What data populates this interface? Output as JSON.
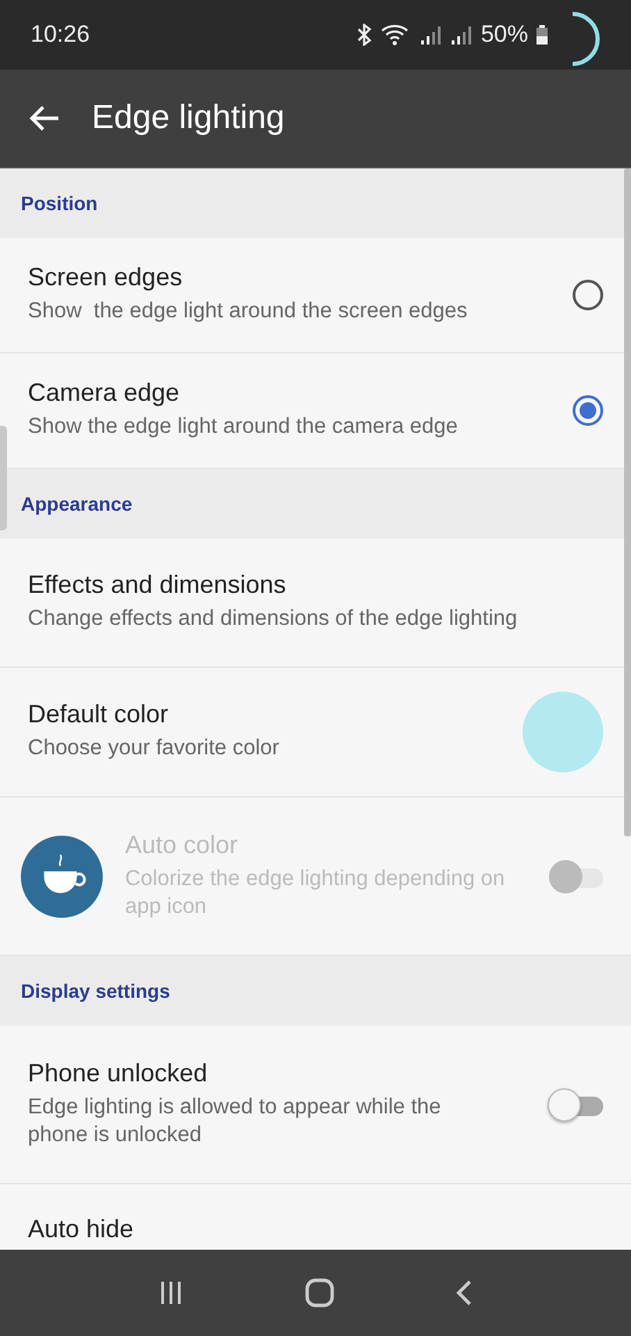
{
  "status_bar": {
    "time": "10:26",
    "battery": "50%"
  },
  "app_bar": {
    "title": "Edge lighting"
  },
  "sections": [
    {
      "title": "Position",
      "items": [
        {
          "kind": "radio",
          "title": "Screen edges",
          "subtitle": "Show  the edge light around the screen edges",
          "selected": false,
          "disabled": false
        },
        {
          "kind": "radio",
          "title": "Camera edge",
          "subtitle": "Show the edge light around the camera edge",
          "selected": true,
          "disabled": false
        }
      ]
    },
    {
      "title": "Appearance",
      "items": [
        {
          "kind": "link",
          "title": "Effects and dimensions",
          "subtitle": "Change effects and dimensions of the edge lighting",
          "disabled": false
        },
        {
          "kind": "color",
          "title": "Default color",
          "subtitle": "Choose your favorite color",
          "color": "#b3e9f0",
          "disabled": false
        },
        {
          "kind": "app-toggle",
          "title": "Auto color",
          "subtitle": "Colorize the edge lighting depending on app icon",
          "on": false,
          "disabled": true
        }
      ]
    },
    {
      "title": "Display settings",
      "items": [
        {
          "kind": "toggle",
          "title": "Phone unlocked",
          "subtitle": "Edge lighting is allowed to appear while the phone is unlocked",
          "on": false,
          "disabled": false
        },
        {
          "kind": "link",
          "title": "Auto hide",
          "disabled": false
        }
      ]
    }
  ]
}
